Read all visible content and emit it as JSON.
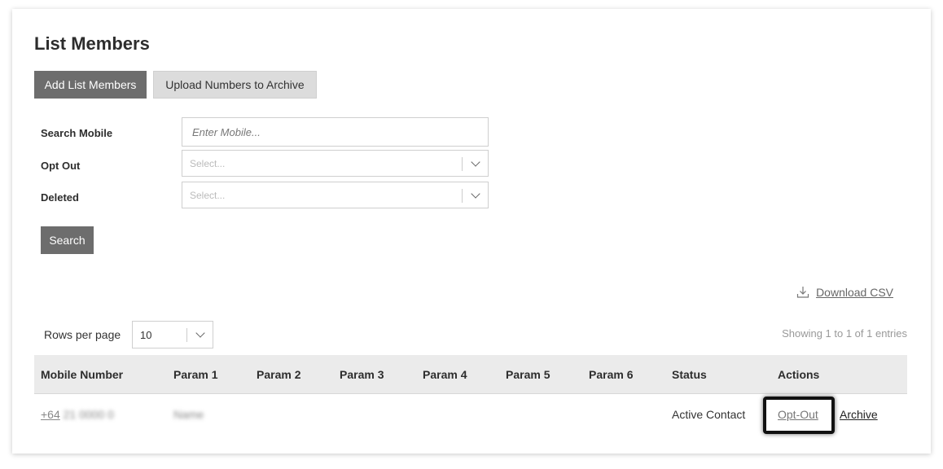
{
  "page": {
    "title": "List Members"
  },
  "toolbar": {
    "add_label": "Add List Members",
    "upload_label": "Upload Numbers to Archive"
  },
  "filters": {
    "search_mobile_label": "Search Mobile",
    "search_mobile_placeholder": "Enter Mobile...",
    "opt_out_label": "Opt Out",
    "opt_out_placeholder": "Select...",
    "deleted_label": "Deleted",
    "deleted_placeholder": "Select...",
    "search_button": "Search"
  },
  "download": {
    "label": "Download CSV",
    "icon": "download-icon"
  },
  "pagination": {
    "rows_label": "Rows per page",
    "rows_value": "10",
    "showing": "Showing 1 to 1 of 1 entries"
  },
  "table": {
    "headers": [
      "Mobile Number",
      "Param 1",
      "Param 2",
      "Param 3",
      "Param 4",
      "Param 5",
      "Param 6",
      "Status",
      "Actions"
    ],
    "rows": [
      {
        "mobile_prefix": "+64",
        "mobile_rest": "21 0000 0",
        "param1": "Name",
        "status": "Active Contact",
        "actions": [
          "Opt-Out",
          "Archive"
        ]
      }
    ]
  }
}
